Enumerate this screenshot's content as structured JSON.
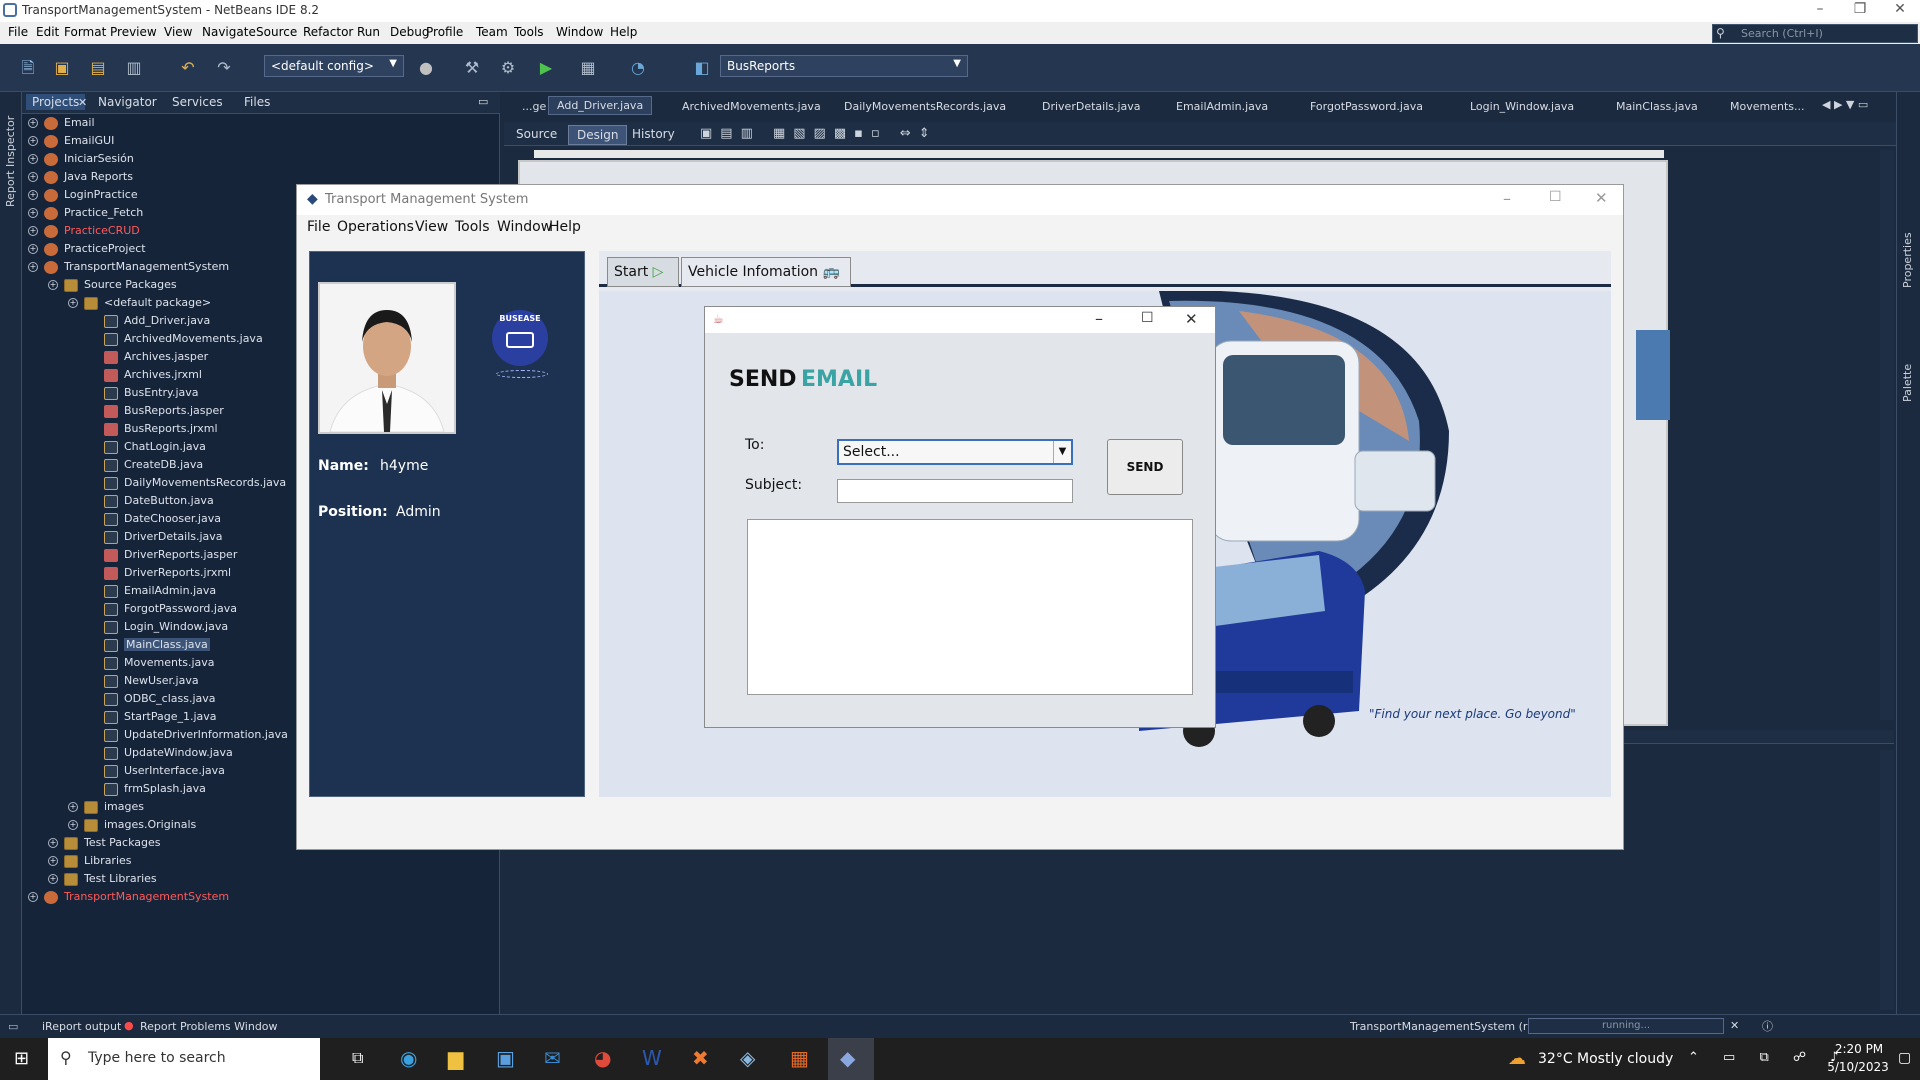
{
  "ide": {
    "title": "TransportManagementSystem - NetBeans IDE 8.2",
    "menu": [
      "File",
      "Edit",
      "Format",
      "Preview",
      "View",
      "Navigate",
      "Source",
      "Refactor",
      "Run",
      "Debug",
      "Profile",
      "Team",
      "Tools",
      "Window",
      "Help"
    ],
    "search_placeholder": "Search (Ctrl+I)",
    "config": "<default config>",
    "report_combo": "BusReports",
    "report_inspector": "Report Inspector",
    "panel_tabs": [
      "Projects",
      "Navigator",
      "Services",
      "Files"
    ],
    "tree": [
      {
        "label": "Email",
        "indent": 0,
        "icon": "proj"
      },
      {
        "label": "EmailGUI",
        "indent": 0,
        "icon": "proj"
      },
      {
        "label": "IniciarSesión",
        "indent": 0,
        "icon": "proj"
      },
      {
        "label": "Java Reports",
        "indent": 0,
        "icon": "proj"
      },
      {
        "label": "LoginPractice",
        "indent": 0,
        "icon": "proj"
      },
      {
        "label": "Practice_Fetch",
        "indent": 0,
        "icon": "proj"
      },
      {
        "label": "PracticeCRUD",
        "indent": 0,
        "icon": "proj",
        "red": true
      },
      {
        "label": "PracticeProject",
        "indent": 0,
        "icon": "proj"
      },
      {
        "label": "TransportManagementSystem",
        "indent": 0,
        "icon": "proj"
      },
      {
        "label": "Source Packages",
        "indent": 1,
        "icon": "pkg"
      },
      {
        "label": "<default package>",
        "indent": 2,
        "icon": "pkg"
      },
      {
        "label": "Add_Driver.java",
        "indent": 3,
        "icon": "java"
      },
      {
        "label": "ArchivedMovements.java",
        "indent": 3,
        "icon": "java"
      },
      {
        "label": "Archives.jasper",
        "indent": 3,
        "icon": "jr"
      },
      {
        "label": "Archives.jrxml",
        "indent": 3,
        "icon": "jr"
      },
      {
        "label": "BusEntry.java",
        "indent": 3,
        "icon": "java"
      },
      {
        "label": "BusReports.jasper",
        "indent": 3,
        "icon": "jr"
      },
      {
        "label": "BusReports.jrxml",
        "indent": 3,
        "icon": "jr"
      },
      {
        "label": "ChatLogin.java",
        "indent": 3,
        "icon": "java"
      },
      {
        "label": "CreateDB.java",
        "indent": 3,
        "icon": "java"
      },
      {
        "label": "DailyMovementsRecords.java",
        "indent": 3,
        "icon": "java"
      },
      {
        "label": "DateButton.java",
        "indent": 3,
        "icon": "java"
      },
      {
        "label": "DateChooser.java",
        "indent": 3,
        "icon": "java"
      },
      {
        "label": "DriverDetails.java",
        "indent": 3,
        "icon": "java"
      },
      {
        "label": "DriverReports.jasper",
        "indent": 3,
        "icon": "jr"
      },
      {
        "label": "DriverReports.jrxml",
        "indent": 3,
        "icon": "jr"
      },
      {
        "label": "EmailAdmin.java",
        "indent": 3,
        "icon": "java"
      },
      {
        "label": "ForgotPassword.java",
        "indent": 3,
        "icon": "java"
      },
      {
        "label": "Login_Window.java",
        "indent": 3,
        "icon": "java"
      },
      {
        "label": "MainClass.java",
        "indent": 3,
        "icon": "java",
        "selected": true
      },
      {
        "label": "Movements.java",
        "indent": 3,
        "icon": "java"
      },
      {
        "label": "NewUser.java",
        "indent": 3,
        "icon": "java"
      },
      {
        "label": "ODBC_class.java",
        "indent": 3,
        "icon": "java"
      },
      {
        "label": "StartPage_1.java",
        "indent": 3,
        "icon": "java"
      },
      {
        "label": "UpdateDriverInformation.java",
        "indent": 3,
        "icon": "java"
      },
      {
        "label": "UpdateWindow.java",
        "indent": 3,
        "icon": "java"
      },
      {
        "label": "UserInterface.java",
        "indent": 3,
        "icon": "java"
      },
      {
        "label": "frmSplash.java",
        "indent": 3,
        "icon": "java"
      },
      {
        "label": "images",
        "indent": 2,
        "icon": "pkg"
      },
      {
        "label": "images.Originals",
        "indent": 2,
        "icon": "pkg"
      },
      {
        "label": "Test Packages",
        "indent": 1,
        "icon": "pkg"
      },
      {
        "label": "Libraries",
        "indent": 1,
        "icon": "pkg"
      },
      {
        "label": "Test Libraries",
        "indent": 1,
        "icon": "pkg"
      },
      {
        "label": "TransportManagementSystem",
        "indent": 0,
        "icon": "proj",
        "red": true
      }
    ],
    "editor_tabs": [
      "...ge",
      "Add_Driver.java",
      "ArchivedMovements.java",
      "DailyMovementsRecords.java",
      "DriverDetails.java",
      "EmailAdmin.java",
      "ForgotPassword.java",
      "Login_Window.java",
      "MainClass.java",
      "Movements..."
    ],
    "sub_tabs": [
      "Source",
      "Design",
      "History"
    ],
    "right_labels": [
      "Properties",
      "Palette"
    ],
    "status_left": [
      "iReport output",
      "Report Problems Window"
    ],
    "status_run": "TransportManagementSystem (run)",
    "status_progress": "running..."
  },
  "app": {
    "title": "Transport Management System",
    "menu": [
      "File",
      "Operations",
      "View",
      "Tools",
      "Window",
      "Help"
    ],
    "name_label": "Name:",
    "name_value": "h4yme",
    "position_label": "Position:",
    "position_value": "Admin",
    "logo_text": "BUSEASE",
    "tabs": [
      "Start",
      "Vehicle Infomation"
    ],
    "tagline": "\"Find your next place. Go beyond\""
  },
  "dialog": {
    "title_send": "SEND",
    "title_email": "EMAIL",
    "to_label": "To:",
    "to_value": "Select...",
    "subject_label": "Subject:",
    "subject_value": "",
    "send_button": "SEND",
    "accent": "#3aa3a3"
  },
  "taskbar": {
    "search_placeholder": "Type here to search",
    "weather": "32°C  Mostly cloudy",
    "time": "2:20 PM",
    "date": "5/10/2023"
  }
}
